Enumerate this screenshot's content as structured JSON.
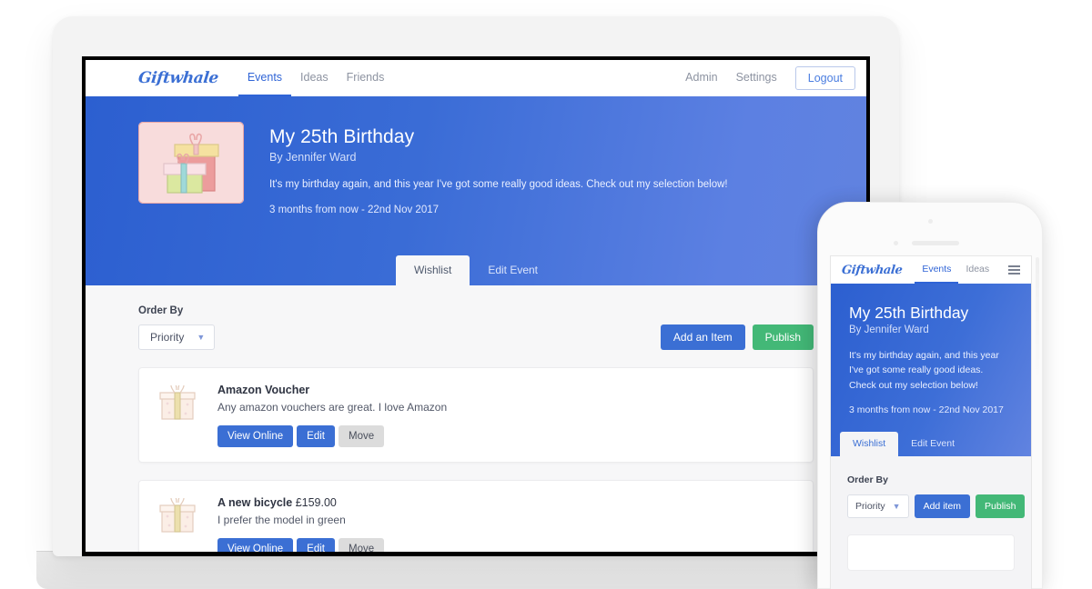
{
  "colors": {
    "brand_blue": "#3b6fd4",
    "hero_left": "#2c5fd0",
    "hero_right": "#6183e0",
    "green": "#43b877",
    "gray_button": "#dcdcdc"
  },
  "desktop": {
    "nav": {
      "logo": "Giftwhale",
      "left_items": [
        {
          "label": "Events",
          "active": true
        },
        {
          "label": "Ideas",
          "active": false
        },
        {
          "label": "Friends",
          "active": false
        }
      ],
      "right_items": [
        {
          "label": "Admin"
        },
        {
          "label": "Settings"
        }
      ],
      "logout_label": "Logout"
    },
    "hero": {
      "thumb_icon": "gift-boxes-illustration",
      "title": "My 25th Birthday",
      "byline": "By Jennifer Ward",
      "description": "It's my birthday again, and this year I've got some really good ideas. Check out my selection below!",
      "date": "3 months from now - 22nd Nov 2017",
      "tabs": [
        {
          "label": "Wishlist",
          "active": true
        },
        {
          "label": "Edit Event",
          "active": false
        }
      ]
    },
    "toolbar": {
      "order_by_label": "Order By",
      "order_by_value": "Priority",
      "add_item_label": "Add an Item",
      "publish_label": "Publish"
    },
    "items": [
      {
        "icon": "gift-box-icon",
        "title": "Amazon Voucher",
        "price": "",
        "description": "Any amazon vouchers are great. I love Amazon",
        "buttons": [
          {
            "label": "View Online",
            "style": "blue"
          },
          {
            "label": "Edit",
            "style": "blue"
          },
          {
            "label": "Move",
            "style": "gray"
          }
        ]
      },
      {
        "icon": "gift-box-icon",
        "title": "A new bicycle",
        "price": "£159.00",
        "description": "I prefer the model in green",
        "buttons": [
          {
            "label": "View Online",
            "style": "blue"
          },
          {
            "label": "Edit",
            "style": "blue"
          },
          {
            "label": "Move",
            "style": "gray"
          }
        ]
      }
    ]
  },
  "phone": {
    "nav": {
      "logo": "Giftwhale",
      "items": [
        {
          "label": "Events",
          "active": true
        },
        {
          "label": "Ideas",
          "active": false
        }
      ],
      "menu_icon": "hamburger-menu-icon"
    },
    "hero": {
      "title": "My 25th Birthday",
      "byline": "By Jennifer Ward",
      "description_lines": [
        "It's my birthday again, and this year",
        "I've got some really good ideas.",
        "Check out my selection below!"
      ],
      "date": "3 months from now - 22nd Nov 2017",
      "tabs": [
        {
          "label": "Wishlist",
          "active": true
        },
        {
          "label": "Edit Event",
          "active": false
        }
      ]
    },
    "toolbar": {
      "order_by_label": "Order By",
      "order_by_value": "Priority",
      "add_item_label": "Add item",
      "publish_label": "Publish"
    }
  }
}
